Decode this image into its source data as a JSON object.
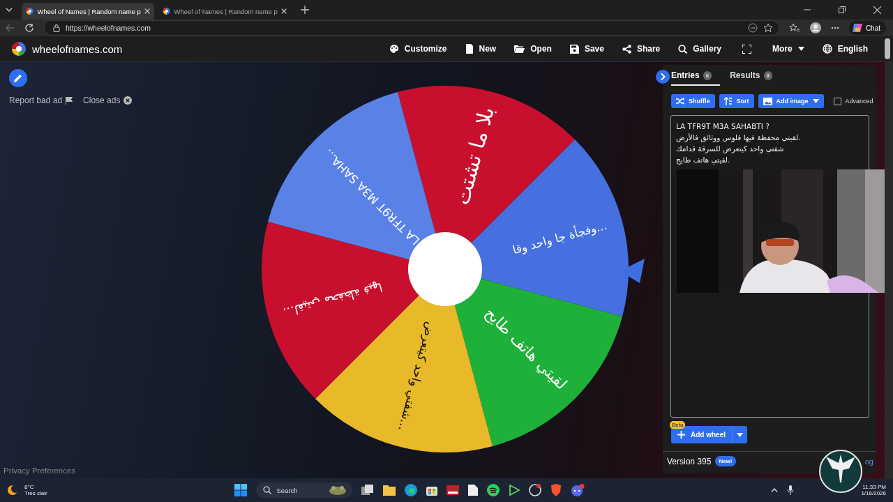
{
  "browser": {
    "tabs": [
      {
        "title": "Wheel of Names | Random name p",
        "selected": true
      },
      {
        "title": "Wheel of Names | Random name p",
        "selected": false
      }
    ],
    "url": "https://wheelofnames.com",
    "chat": "Chat"
  },
  "header": {
    "brand": "wheelofnames.com",
    "menu": [
      {
        "label": "Customize"
      },
      {
        "label": "New"
      },
      {
        "label": "Open"
      },
      {
        "label": "Save"
      },
      {
        "label": "Share"
      },
      {
        "label": "Gallery"
      }
    ],
    "more": "More",
    "language": "English"
  },
  "ads": {
    "report": "Report bad ad",
    "close": "Close ads"
  },
  "privacy": "Privacy Preferences",
  "wheel": {
    "slices": [
      {
        "label": "بلا ما تشتت",
        "color": "#c8102e"
      },
      {
        "label": "وفجأة جا واحد وقا...",
        "color": "#4670e0"
      },
      {
        "label": "لقيتي هاتف طايح",
        "color": "#1fb03a"
      },
      {
        "label": "شفتي واحد كيتعرض...",
        "color": "#e8b928"
      },
      {
        "label": "لقيتي محفظة فيها...",
        "color": "#c8102e"
      },
      {
        "label": "LA TFR9T M3A SAHA...",
        "color": "#5a82e6"
      }
    ]
  },
  "panel": {
    "tabs": [
      {
        "label": "Entries",
        "count": "6",
        "selected": true
      },
      {
        "label": "Results",
        "count": "8",
        "selected": false
      }
    ],
    "buttons": [
      {
        "label": "Shuffle"
      },
      {
        "label": "Sort"
      },
      {
        "label": "Add image"
      }
    ],
    "advanced": {
      "label": "Advanced",
      "checked": false
    },
    "entries": [
      "LA TFR9T M3A SAHABTI ?",
      "لقيتي محفظة فيها فلوس ووثائق فالأرض.",
      "شفتي واحد كيتعرض للسرقة قدامك",
      "لقيتي هاتف طايح."
    ],
    "add_wheel": {
      "label": "Add wheel",
      "badge": "Beta"
    },
    "version": "Version 395",
    "new_badge": "New!",
    "changelog": "og"
  },
  "taskbar": {
    "temperature": "8°C",
    "weather": "Très clair",
    "search": "Search",
    "time": "11:33 PM",
    "date": "1/16/2026"
  }
}
